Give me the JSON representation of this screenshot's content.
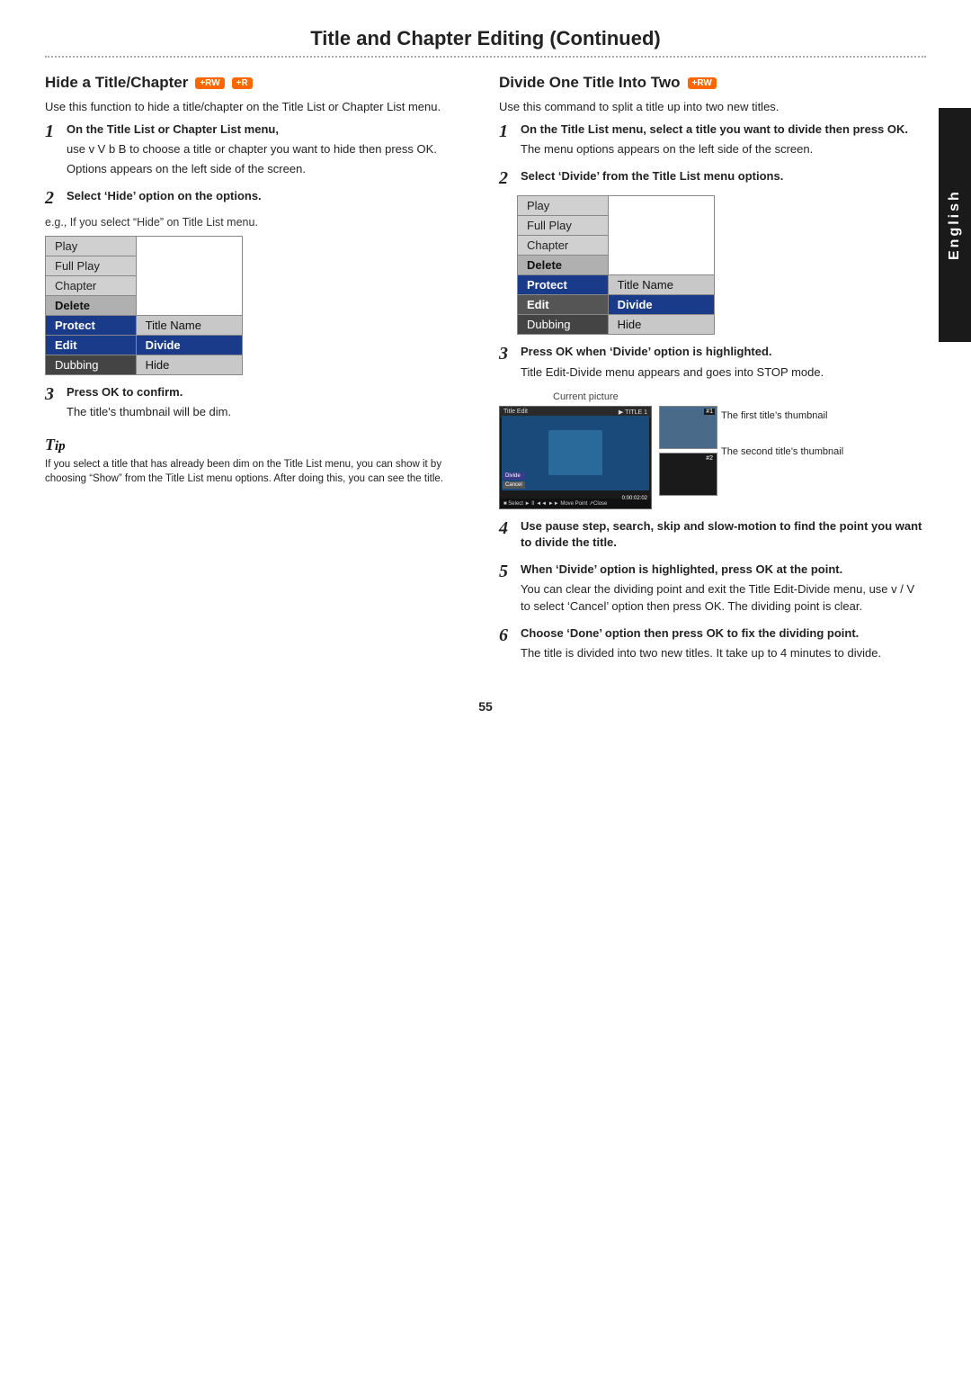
{
  "page": {
    "title": "Title and Chapter Editing (Continued)",
    "page_number": "55"
  },
  "english_label": "English",
  "left_section": {
    "heading": "Hide a Title/Chapter",
    "badge1": "+RW",
    "badge2": "+R",
    "intro": "Use this function to hide a title/chapter on the Title List or Chapter List menu.",
    "step1_bold": "On the Title List or Chapter List menu,",
    "step1_text": "use v  V  b  B to choose a title or chapter you want to hide then press OK.",
    "step1_sub": "Options appears on the left side of the screen.",
    "step2_bold": "Select ‘Hide’ option on the options.",
    "eg_text": "e.g., If you select “Hide” on Title List menu.",
    "menu": {
      "rows": [
        {
          "label": "Play",
          "type": "normal"
        },
        {
          "label": "Full Play",
          "type": "normal"
        },
        {
          "label": "Chapter",
          "type": "normal"
        },
        {
          "label": "Delete",
          "type": "bold"
        },
        {
          "label": "Protect",
          "type": "blue_left",
          "right": "Title Name"
        },
        {
          "label": "Edit",
          "type": "blue_left",
          "right": "Divide"
        },
        {
          "label": "Dubbing",
          "type": "dark_left",
          "right": "Hide"
        }
      ]
    },
    "step3_bold": "Press OK to confirm.",
    "step3_text": "The title's thumbnail will be dim.",
    "tip_title": "ip",
    "tip_text": "If you select a title that has already been dim on the Title List menu, you can show it by choosing “Show” from the Title List menu options. After doing this, you can see the title."
  },
  "right_section": {
    "heading": "Divide One Title Into Two",
    "badge1": "+RW",
    "intro": "Use this command to split a title up into two new titles.",
    "step1_bold": "On the Title List menu, select a title you want to divide then press OK.",
    "step1_text": "The menu options appears on the left side of the screen.",
    "step2_bold": "Select ‘Divide’ from the Title List menu options.",
    "menu": {
      "rows": [
        {
          "label": "Play",
          "type": "normal"
        },
        {
          "label": "Full Play",
          "type": "normal"
        },
        {
          "label": "Chapter",
          "type": "normal"
        },
        {
          "label": "Delete",
          "type": "bold"
        },
        {
          "label": "Protect",
          "type": "blue_left",
          "right": "Title Name"
        },
        {
          "label": "Edit",
          "type": "selected_left",
          "right_selected": "Divide"
        },
        {
          "label": "Dubbing",
          "type": "dark_left",
          "right": "Hide"
        }
      ]
    },
    "step3_bold": "Press OK when ‘Divide’ option is highlighted.",
    "step3_text": "Title Edit-Divide menu appears and goes into STOP mode.",
    "current_picture_label": "Current picture",
    "first_thumb_label": "The first title’s thumbnail",
    "second_thumb_label": "The second title’s thumbnail",
    "screen_title": "Title Edit",
    "screen_subtitle": "Divide",
    "thumb1_num": "#1",
    "thumb2_num": "#2",
    "divide_btn": "Divide",
    "cancel_btn": "Cancel",
    "timecode": "0:00:02:02",
    "bottom_controls": "■ Select  ► II  ◄◄  ►►  Move Point     ↗Close",
    "step4_bold": "Use pause step, search, skip and slow-motion to find the point you want to divide the title.",
    "step5_bold": "When ‘Divide’ option is highlighted, press OK at the point.",
    "step5_text": "You can clear the dividing point and exit the Title Edit-Divide menu, use v / V to select ‘Cancel’ option then press OK. The dividing point is clear.",
    "step6_bold": "Choose ‘Done’ option then press OK to fix the dividing point.",
    "step6_text": "The title is divided into two new titles. It take up to 4 minutes to divide."
  }
}
